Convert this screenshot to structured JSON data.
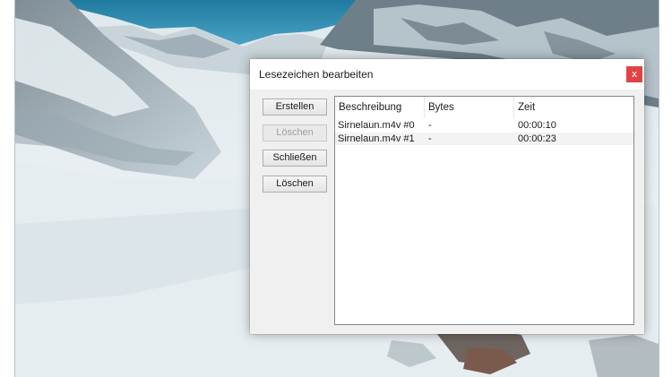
{
  "dialog": {
    "title": "Lesezeichen bearbeiten",
    "close_glyph": "x",
    "buttons": {
      "create": "Erstellen",
      "delete_disabled": "Löschen",
      "close": "Schließen",
      "delete": "Löschen"
    },
    "columns": [
      "Beschreibung",
      "Bytes",
      "Zeit"
    ],
    "rows": [
      {
        "beschreibung": "Sirnelaun.m4v #0",
        "bytes": "-",
        "zeit": "00:00:10"
      },
      {
        "beschreibung": "Sirnelaun.m4v #1",
        "bytes": "-",
        "zeit": "00:00:23"
      }
    ]
  },
  "colors": {
    "close_button": "#e04343",
    "sky": "#2f86a8",
    "snow": "#e9eef1"
  }
}
